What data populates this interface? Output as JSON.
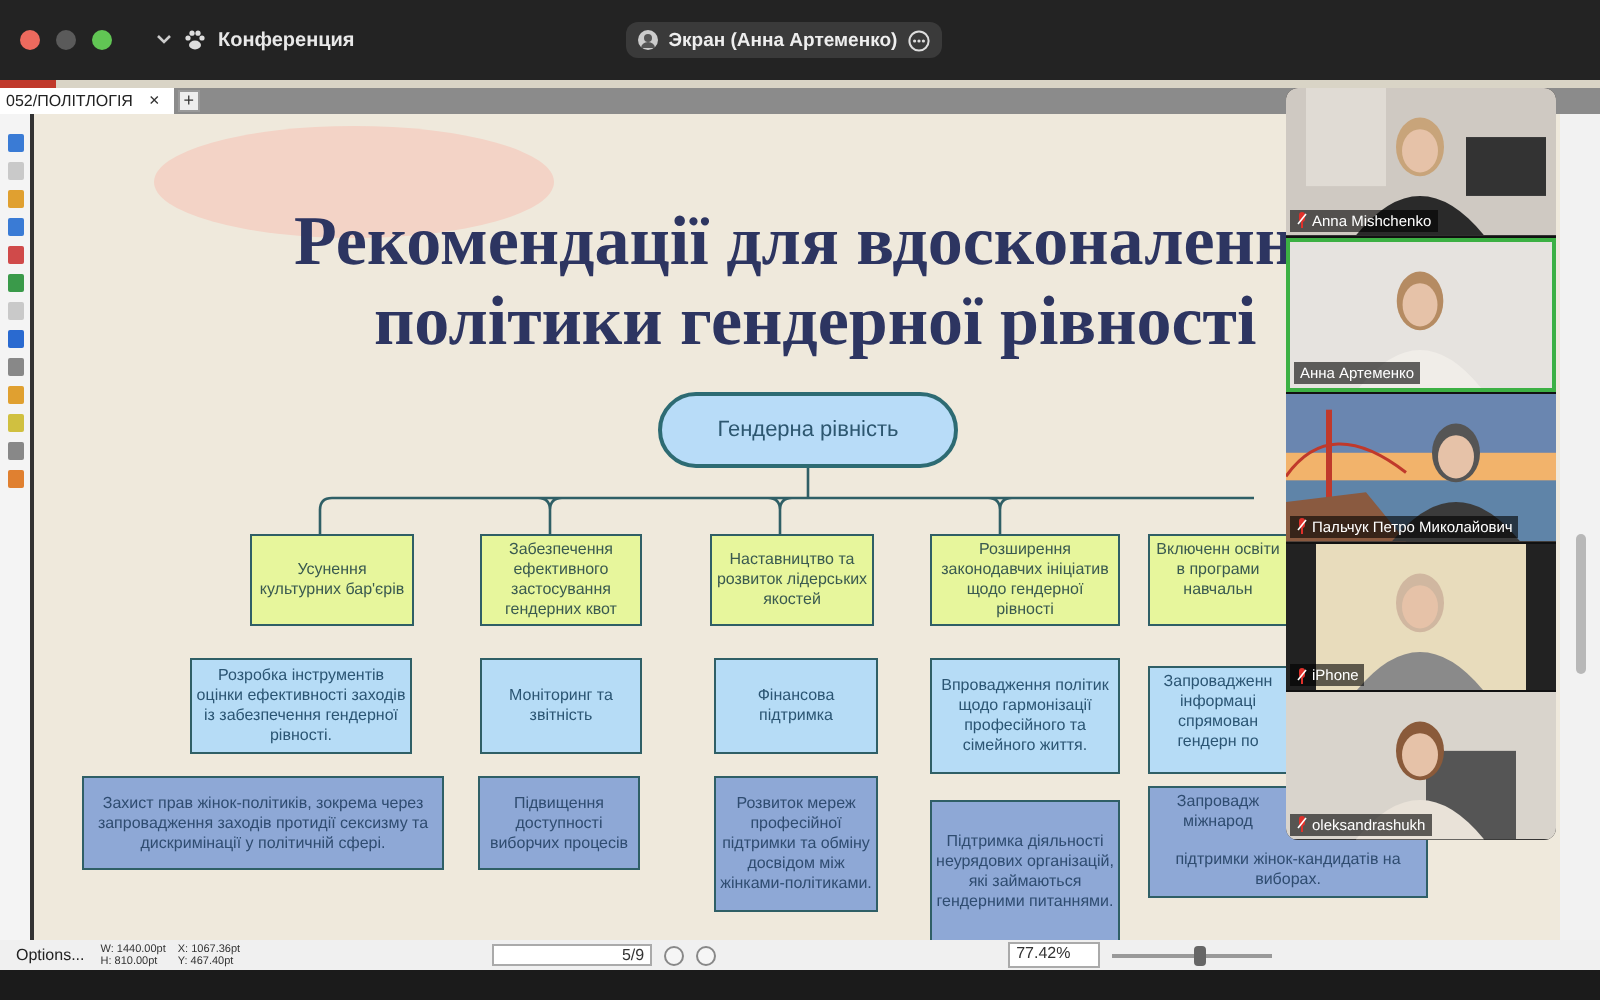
{
  "window": {
    "title": "Конференция",
    "share_label": "Экран (Анна Артеменко)"
  },
  "document_tab": {
    "label": "052/ПОЛІТЛОГІЯ",
    "close": "×",
    "add": "+"
  },
  "slide": {
    "title_lines": [
      "Рекомендації для вдосконаленн",
      "політики гендерної рівності"
    ],
    "root": "Гендерна рівність",
    "columns": [
      {
        "boxes": [
          {
            "kind": "goal",
            "text": "Усунення культурних бар'єрів"
          },
          {
            "kind": "measure",
            "text": "Розробка інструментів оцінки ефективності заходів із забезпечення гендерної рівності."
          },
          {
            "kind": "action",
            "text": "Захист прав жінок-політиків, зокрема через запровадження заходів протидії сексизму та дискримінації у політичній сфері."
          }
        ]
      },
      {
        "boxes": [
          {
            "kind": "goal",
            "text": "Забезпечення ефективного застосування гендерних квот"
          },
          {
            "kind": "measure",
            "text": "Моніторинг та звітність"
          },
          {
            "kind": "action",
            "text": "Підвищення доступності виборчих процесів"
          }
        ]
      },
      {
        "boxes": [
          {
            "kind": "goal",
            "text": "Наставництво та розвиток лідерських якостей"
          },
          {
            "kind": "measure",
            "text": "Фінансова підтримка"
          },
          {
            "kind": "action",
            "text": "Розвиток мереж професійної підтримки та обміну досвідом між жінками-політиками."
          }
        ]
      },
      {
        "boxes": [
          {
            "kind": "goal",
            "text": "Розширення законодавчих ініціатив щодо гендерної рівності"
          },
          {
            "kind": "measure",
            "text": "Впровадження політик щодо гармонізації професійного та сімейного життя."
          },
          {
            "kind": "action",
            "text": "Підтримка діяльності неурядових організацій, які займаються гендерними питаннями."
          }
        ]
      },
      {
        "boxes": [
          {
            "kind": "goal",
            "text": "Включенн освіти в програми навчальн"
          },
          {
            "kind": "measure",
            "text": "Запровадженн інформаці спрямован гендерн по"
          },
          {
            "kind": "action",
            "text": "Запровадж міжнарод",
            "tail": "підтримки жінок-кандидатів на виборах."
          }
        ]
      }
    ]
  },
  "participants": [
    {
      "name": "Anna Mishchenko",
      "muted": true,
      "speaking": false
    },
    {
      "name": "Анна Артеменко",
      "muted": false,
      "speaking": true
    },
    {
      "name": "Пальчук Петро Миколайович",
      "muted": true,
      "speaking": false
    },
    {
      "name": "iPhone",
      "muted": true,
      "speaking": false
    },
    {
      "name": "oleksandrashukh",
      "muted": true,
      "speaking": false
    }
  ],
  "status_bar": {
    "options": "Options...",
    "size_w": "W: 1440.00pt",
    "size_h": "H: 810.00pt",
    "pos_x": "X: 1067.36pt",
    "pos_y": "Y: 467.40pt",
    "page": "5/9",
    "zoom": "77.42%",
    "level": 0.55
  }
}
